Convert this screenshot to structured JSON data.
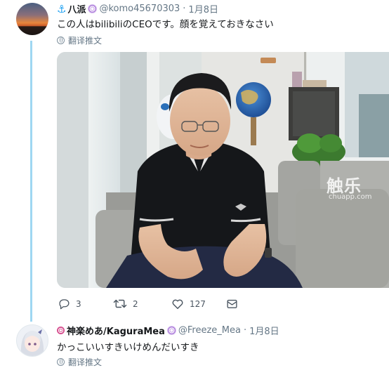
{
  "tweet1": {
    "display_name": "八派",
    "handle": "@komo45670303",
    "separator": "·",
    "date": "1月8日",
    "text": "この人はbilibiliのCEOです。顔を覚えておきなさい",
    "translate_label": "翻译推文",
    "media": {
      "watermark_brand": "触乐",
      "watermark_url": "chuapp.com"
    },
    "actions": {
      "reply_count": "3",
      "retweet_count": "2",
      "like_count": "127"
    }
  },
  "tweet2": {
    "display_name": "神楽めあ/KaguraMea",
    "handle": "@Freeze_Mea",
    "separator": "·",
    "date": "1月8日",
    "text": "かっこいいすきいけめんだいすき",
    "translate_label": "翻译推文"
  },
  "colors": {
    "accent": "#1da1f2",
    "thread_line": "#9fd7f2",
    "muted": "#657786"
  }
}
